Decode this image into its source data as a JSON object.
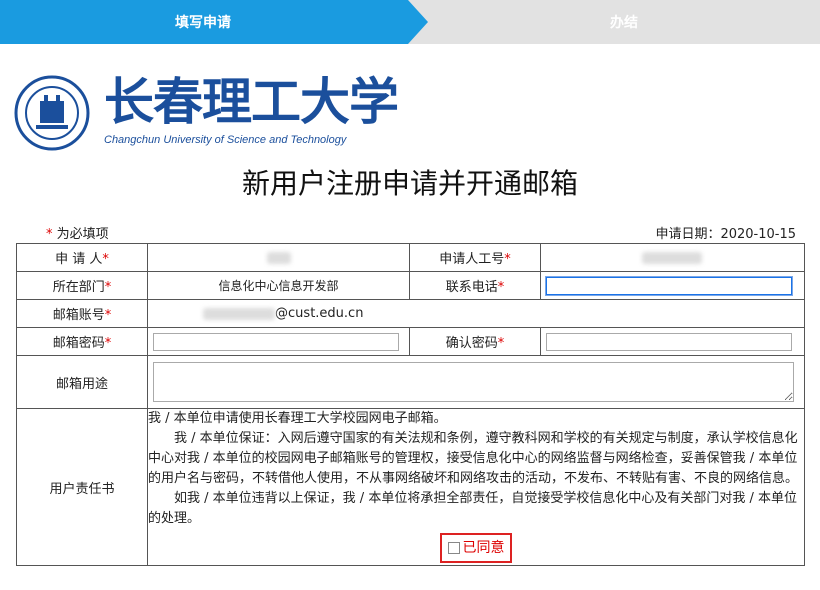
{
  "steps": {
    "step1": "填写申请",
    "step2": "办结"
  },
  "brand": {
    "cn": "长春理工大学",
    "en": "Changchun University of Science and Technology"
  },
  "page": {
    "title": "新用户注册申请并开通邮箱",
    "required_note": "为必填项",
    "apply_date": "申请日期：2020-10-15"
  },
  "fields": {
    "applicant": "申 请 人",
    "applicant_id": "申请人工号",
    "department": "所在部门",
    "department_value": "信息化中心信息开发部",
    "phone": "联系电话",
    "email_account": "邮箱账号",
    "email_suffix": "@cust.edu.cn",
    "email_password": "邮箱密码",
    "confirm_password": "确认密码",
    "email_purpose": "邮箱用途",
    "responsibility": "用户责任书"
  },
  "responsibility_text": {
    "p1": "我 / 本单位申请使用长春理工大学校园网电子邮箱。",
    "p2": "我 / 本单位保证：入网后遵守国家的有关法规和条例，遵守教科网和学校的有关规定与制度，承认学校信息化中心对我 / 本单位的校园网电子邮箱账号的管理权，接受信息化中心的网络监督与网络检查，妥善保管我 / 本单位的用户名与密码，不转借他人使用，不从事网络破坏和网络攻击的活动，不发布、不转贴有害、不良的网络信息。",
    "p3": "如我 / 本单位违背以上保证，我 / 本单位将承担全部责任，自觉接受学校信息化中心及有关部门对我 / 本单位的处理。"
  },
  "agree_label": "已同意",
  "colors": {
    "step_active": "#1a9be0",
    "brand": "#1b4f9c",
    "required": "#dd0000"
  }
}
